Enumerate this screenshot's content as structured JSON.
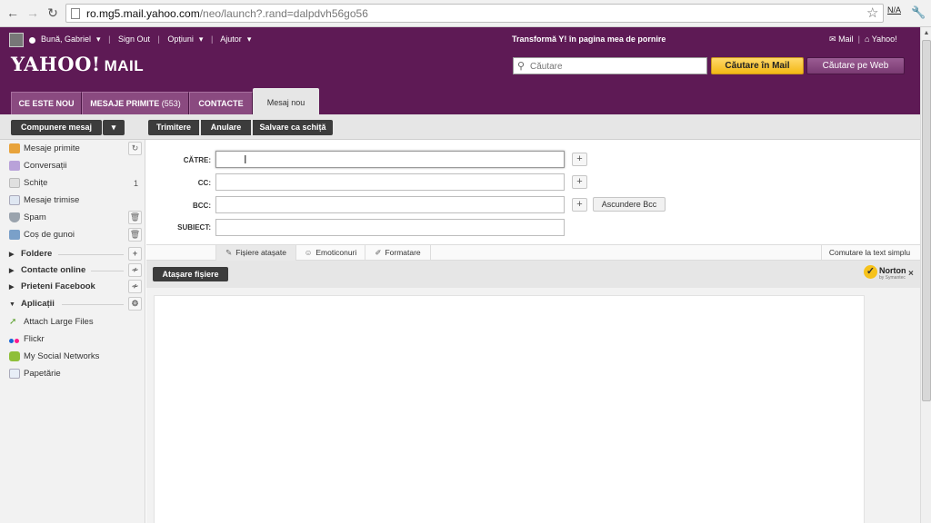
{
  "browser": {
    "url_host": "ro.mg5.mail.yahoo.com",
    "url_path": "/neo/launch?.rand=dalpdvh56go56",
    "na_label": "N/A"
  },
  "header": {
    "user_name": "Bună, Gabriel",
    "sign_out": "Sign Out",
    "options": "Opțiuni",
    "help": "Ajutor",
    "promo": "Transformă Y! în pagina mea de pornire",
    "mail_link": "Mail",
    "yahoo_link": "Yahoo!",
    "logo_text": "YAHOO!",
    "logo_mail": "MAIL",
    "search_placeholder": "Căutare",
    "search_mail_btn": "Căutare în Mail",
    "search_web_btn": "Căutare pe Web"
  },
  "tabs": [
    {
      "label": "CE ESTE NOU",
      "count": ""
    },
    {
      "label": "MESAJE PRIMITE",
      "count": "(553)"
    },
    {
      "label": "CONTACTE",
      "count": ""
    },
    {
      "label": "Mesaj nou",
      "count": ""
    }
  ],
  "toolbar": {
    "compose": "Compunere mesaj",
    "compose_arrow": "▾",
    "send": "Trimitere",
    "cancel": "Anulare",
    "save_draft": "Salvare ca schiță"
  },
  "sidebar": {
    "inbox": "Mesaje primite",
    "conversations": "Conversații",
    "drafts": "Schițe",
    "drafts_count": "1",
    "sent": "Mesaje trimise",
    "spam": "Spam",
    "trash": "Coș de gunoi",
    "folders": "Foldere",
    "online_contacts": "Contacte online",
    "facebook_friends": "Prieteni Facebook",
    "applications": "Aplicații",
    "app_attach": "Attach Large Files",
    "app_flickr": "Flickr",
    "app_social": "My Social Networks",
    "app_stationery": "Papetărie"
  },
  "compose": {
    "to_label": "CĂTRE:",
    "cc_label": "CC:",
    "bcc_label": "BCC:",
    "subject_label": "SUBIECT:",
    "to_value": "",
    "cc_value": "",
    "bcc_value": "",
    "subject_value": "",
    "hide_bcc": "Ascundere Bcc",
    "plus": "+"
  },
  "format_bar": {
    "attachments": "Fișiere atașate",
    "emoticons": "Emoticonuri",
    "formatting": "Formatare",
    "plain_text": "Comutare la text simplu"
  },
  "attach": {
    "button": "Atașare fișiere",
    "norton": "Norton",
    "norton_by": "by Symantec",
    "close": "×"
  },
  "colors": {
    "header_purple": "#5e1a55",
    "tab_purple": "#8a4a80",
    "search_mail_yellow": "#f3b814"
  }
}
